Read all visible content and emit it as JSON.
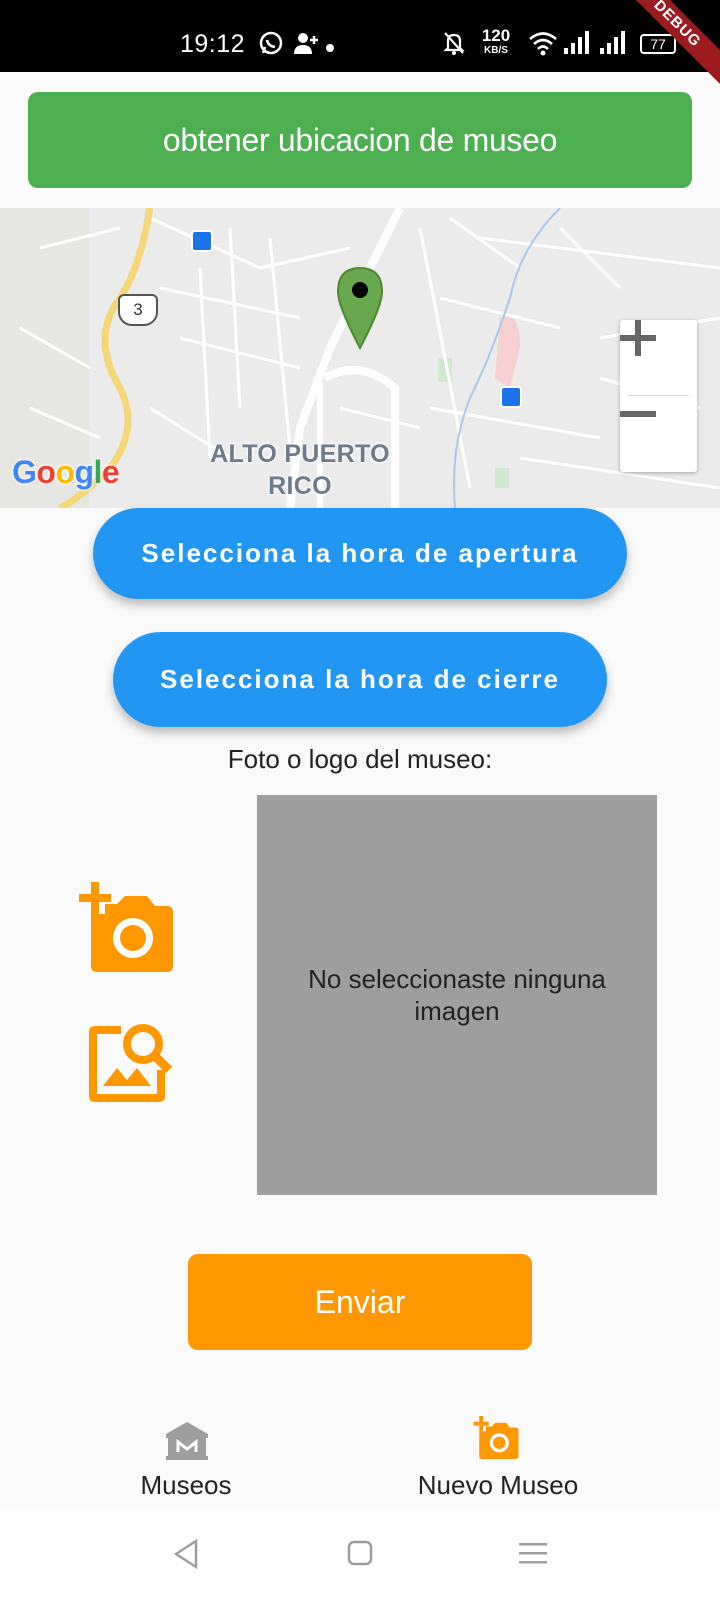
{
  "status_bar": {
    "time": "19:12",
    "net_speed_top": "120",
    "net_speed_bottom": "KB/S",
    "battery": "77",
    "debug_ribbon": "DEBUG"
  },
  "actions": {
    "get_location_label": "obtener ubicacion de museo",
    "open_time_label": "Selecciona la hora de apertura",
    "close_time_label": "Selecciona la hora de cierre",
    "submit_label": "Enviar"
  },
  "map": {
    "district_label_line1": "ALTO PUERTO",
    "district_label_line2": "RICO",
    "route_shield": "3",
    "google_logo": "Google",
    "zoom_in": "+",
    "zoom_out": "−"
  },
  "photo": {
    "label": "Foto o logo del museo:",
    "empty_text": "No seleccionaste ninguna imagen"
  },
  "bottom_nav": {
    "items": [
      {
        "label": "Museos",
        "active": false
      },
      {
        "label": "Nuevo Museo",
        "active": true
      }
    ]
  },
  "colors": {
    "green": "#4caf50",
    "blue": "#2196f3",
    "orange": "#ff9800",
    "inactive": "#9e9e9e"
  }
}
